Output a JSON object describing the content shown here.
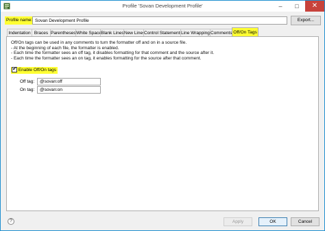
{
  "window": {
    "title": "Profile 'Sovan Development Profile'",
    "controls": {
      "minimize": "–",
      "maximize": "□",
      "close": "✕"
    }
  },
  "profile": {
    "label": "Profile name:",
    "value": "Sovan Development Profile",
    "export_label": "Export..."
  },
  "tabs": [
    {
      "label": "Indentation"
    },
    {
      "label": "Braces"
    },
    {
      "label": "Parentheses"
    },
    {
      "label": "White Space"
    },
    {
      "label": "Blank Lines"
    },
    {
      "label": "New Lines"
    },
    {
      "label": "Control Statements"
    },
    {
      "label": "Line Wrapping"
    },
    {
      "label": "Comments"
    },
    {
      "label": "Off/On Tags",
      "active": true
    }
  ],
  "panel": {
    "description": [
      "Off/On tags can be used in any comments to turn the formatter off and on in a source file.",
      "- At the beginning of each file, the formatter is enabled.",
      "- Each time the formatter sees an off tag, it disables formatting for that comment and the source after it.",
      "- Each time the formatter sees an on tag, it enables formatting for the source after that comment."
    ],
    "enable_label": "Enable Off/On tags",
    "enable_checked": true,
    "off_tag": {
      "label": "Off tag:",
      "value": "@sovan:off"
    },
    "on_tag": {
      "label": "On tag:",
      "value": "@sovan:on"
    }
  },
  "footer": {
    "help": "?",
    "apply": "Apply",
    "ok": "OK",
    "cancel": "Cancel"
  },
  "colors": {
    "highlight": "#ffff33",
    "window_border": "#1e8fd0",
    "close_button": "#c7423b"
  }
}
